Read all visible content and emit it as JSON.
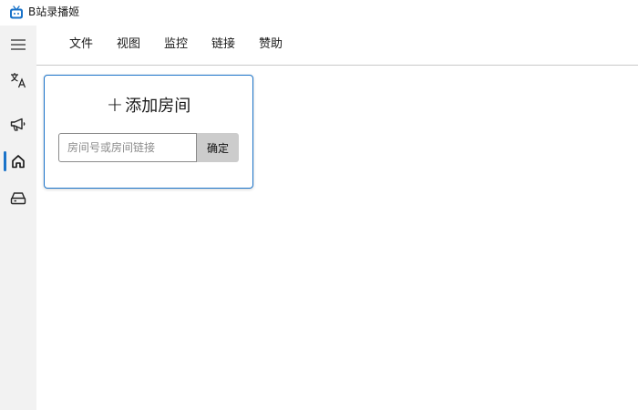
{
  "window": {
    "title": "B站录播姬"
  },
  "sidebar": {
    "items": [
      {
        "icon": "hamburger-menu-icon"
      },
      {
        "icon": "translate-icon"
      },
      {
        "icon": "megaphone-icon"
      },
      {
        "icon": "home-icon",
        "active": true
      },
      {
        "icon": "hard-drive-icon"
      }
    ],
    "accent_color": "#1a73c9"
  },
  "menu": {
    "items": [
      "文件",
      "视图",
      "监控",
      "链接",
      "赞助"
    ]
  },
  "add_room_card": {
    "plus": "+",
    "title": "添加房间",
    "input_value": "",
    "input_placeholder": "房间号或房间链接",
    "confirm_label": "确定"
  }
}
